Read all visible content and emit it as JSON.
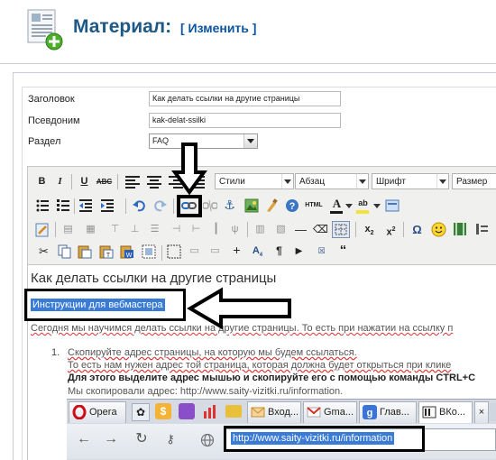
{
  "header": {
    "title": "Материал:",
    "edit_link": "[ Изменить ]"
  },
  "form": {
    "title_label": "Заголовок",
    "title_value": "Как делать ссылки на другие страницы",
    "alias_label": "Псевдоним",
    "alias_value": "kak-delat-ssilki",
    "section_label": "Раздел",
    "section_value": "FAQ"
  },
  "toolbar": {
    "styles_select": "Стили",
    "paragraph_select": "Абзац",
    "font_select": "Шрифт",
    "size_select": "Размер",
    "html_label": "HTML"
  },
  "content": {
    "heading": "Как делать ссылки на другие страницы",
    "selected_link_text": "Инструкции для вебмастера",
    "intro": "Сегодня мы научимся делать ссылки на другие страницы. То есть при нажатии на ссылку п",
    "list_number": "1.",
    "step_line1": "Скопируйте адрес страницы, на которую мы будем ссылаться.",
    "step_line2": "То есть нам нужен адрес той страница, которая должна будет открыться при кликe",
    "step_line3": "Для этого выделите адрес мышью и скопируйте его с помощью команды CTRL+C",
    "step_line4": "Мы скопировали адрес: http://www.saity-vizitki.ru/information."
  },
  "browser": {
    "tabs": [
      {
        "label": "Opera",
        "icon": "opera-icon",
        "color": "#cc0f16"
      },
      {
        "label": "Вход...",
        "icon": "mail-icon",
        "color": "#e8a33b"
      },
      {
        "label": "Gma...",
        "icon": "gmail-icon",
        "color": "#d93025"
      },
      {
        "label": "Глав...",
        "icon": "google-icon",
        "color": "#3b74d9"
      },
      {
        "label": "ВКо...",
        "icon": "vk-icon",
        "color": "#4a6f9c"
      }
    ],
    "url": "http://www.saity-vizitki.ru/information"
  },
  "colors": {
    "title_blue": "#1d5987",
    "selection_blue": "#3a7bd5",
    "annotation_black": "#000000"
  }
}
